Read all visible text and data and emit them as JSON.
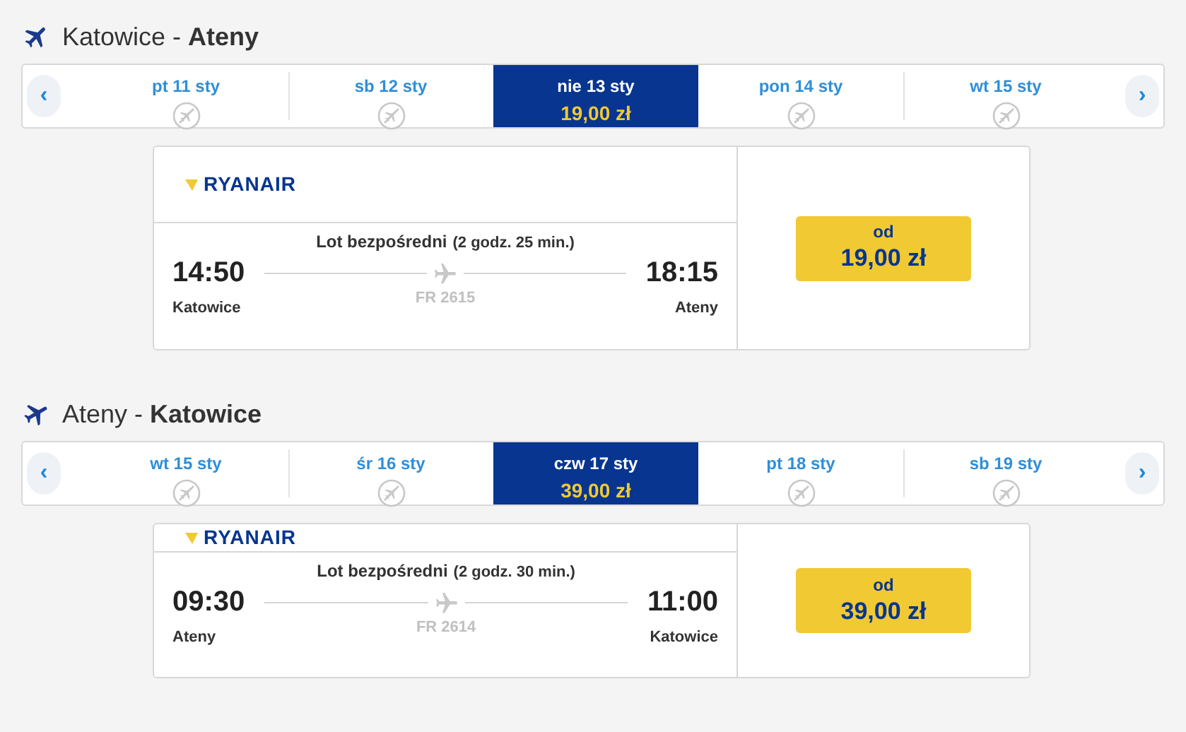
{
  "sections": [
    {
      "heading": "Katowice - **Ateny**",
      "prev": "‹",
      "next": "›",
      "dates": [
        {
          "label": "pt 11 sty",
          "selected": false
        },
        {
          "label": "sb 12 sty",
          "selected": false
        },
        {
          "label": "nie 13 sty",
          "selected": true,
          "price": "19,00 zł"
        },
        {
          "label": "pon 14 sty",
          "selected": false
        },
        {
          "label": "wt 15 sty",
          "selected": false
        }
      ],
      "flight": {
        "airline": "RYANAIR",
        "type": "Lot bezpośredni",
        "duration": "(2 godz. 25 min.)",
        "depart_time": "14:50",
        "depart_city": "Katowice",
        "arrive_time": "18:15",
        "arrive_city": "Ateny",
        "number": "FR 2615",
        "price_prefix": "od",
        "price": "19,00 zł"
      }
    },
    {
      "heading": "Ateny - **Katowice**",
      "prev": "‹",
      "next": "›",
      "dates": [
        {
          "label": "wt 15 sty",
          "selected": false
        },
        {
          "label": "śr 16 sty",
          "selected": false
        },
        {
          "label": "czw 17 sty",
          "selected": true,
          "price": "39,00 zł"
        },
        {
          "label": "pt 18 sty",
          "selected": false
        },
        {
          "label": "sb 19 sty",
          "selected": false
        }
      ],
      "flight": {
        "airline": "RYANAIR",
        "type": "Lot bezpośredni",
        "duration": "(2 godz. 30 min.)",
        "depart_time": "09:30",
        "depart_city": "Ateny",
        "arrive_time": "11:00",
        "arrive_city": "Katowice",
        "number": "FR 2614",
        "price_prefix": "od",
        "price": "39,00 zł"
      }
    }
  ]
}
